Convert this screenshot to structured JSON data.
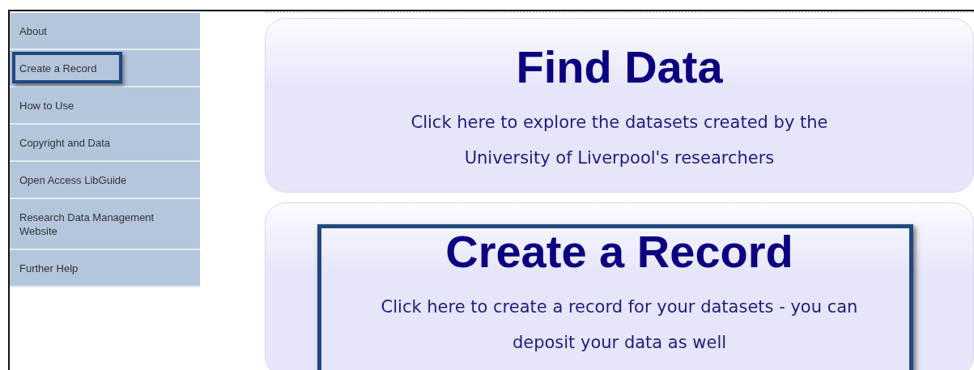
{
  "sidebar": {
    "items": [
      {
        "label": "About",
        "highlighted": false
      },
      {
        "label": "Create a Record",
        "highlighted": true
      },
      {
        "label": "How to Use",
        "highlighted": false
      },
      {
        "label": "Copyright and Data",
        "highlighted": false
      },
      {
        "label": "Open Access LibGuide",
        "highlighted": false
      },
      {
        "label": "Research Data Management Website",
        "highlighted": false
      },
      {
        "label": "Further Help",
        "highlighted": false
      }
    ]
  },
  "cards": [
    {
      "title": "Find Data",
      "description_lines": [
        "Click here to explore the datasets created by the",
        "University of Liverpool's researchers"
      ],
      "highlighted": false
    },
    {
      "title": "Create a Record",
      "description_lines": [
        "Click here to create a record for your datasets - you can",
        "deposit your data as well"
      ],
      "highlighted": true
    }
  ]
}
